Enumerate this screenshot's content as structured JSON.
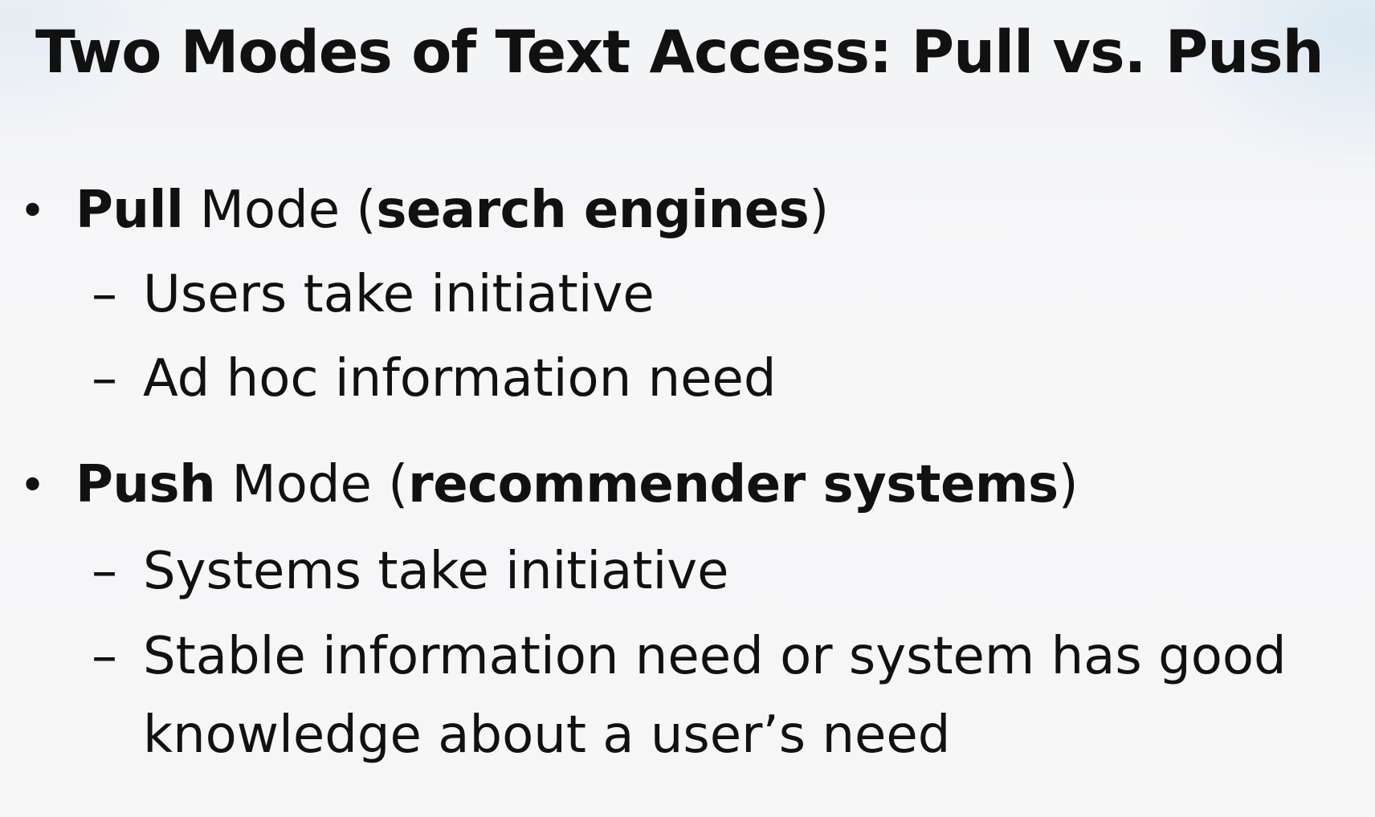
{
  "slide": {
    "title": "Two Modes of Text Access: Pull vs. Push",
    "pull": {
      "bullet": "•",
      "name": "Pull",
      "word": " Mode (",
      "examples": "search engines",
      "close": ")",
      "sub": [
        "Users take initiative",
        "Ad hoc information need"
      ]
    },
    "push": {
      "bullet": "•",
      "name": "Push",
      "word": " Mode (",
      "examples": "recommender systems",
      "close": ")",
      "sub": [
        "Systems take initiative",
        "Stable information need or system has good",
        "knowledge about a user’s need"
      ]
    },
    "dash": "–"
  }
}
